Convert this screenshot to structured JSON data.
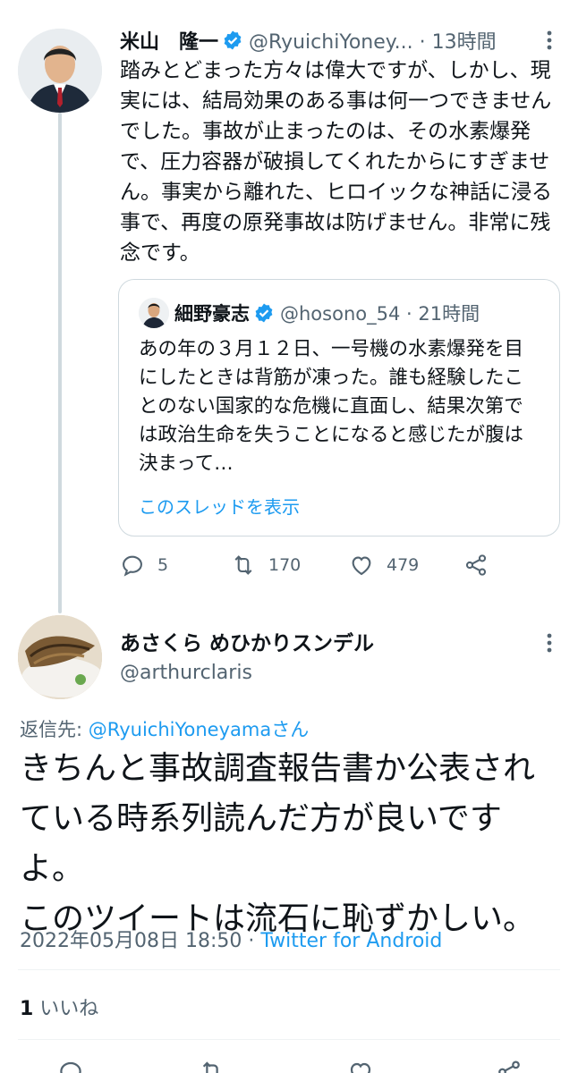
{
  "original_tweet": {
    "name": "米山　隆一",
    "handle": "@RyuichiYoney...",
    "time": "13時間",
    "text": "踏みとどまった方々は偉大ですが、しかし、現実には、結局効果のある事は何一つできませんでした。事故が止まったのは、その水素爆発で、圧力容器が破損してくれたからにすぎません。事実から離れた、ヒロイックな神話に浸る事で、再度の原発事故は防げません。非常に残念です。",
    "actions": {
      "reply_count": "5",
      "retweet_count": "170",
      "like_count": "479"
    }
  },
  "quoted_tweet": {
    "name": "細野豪志",
    "handle": "@hosono_54",
    "time": "21時間",
    "text": "あの年の３月１２日、一号機の水素爆発を目にしたときは背筋が凍った。誰も経験したことのない国家的な危機に直面し、結果次第では政治生命を失うことになると感じたが腹は決まって…",
    "show_thread": "このスレッドを表示"
  },
  "reply_tweet": {
    "name": "あさくら めひかりスンデル",
    "handle": "@arthurclaris",
    "replying_prefix": "返信先: ",
    "replying_mention": "@RyuichiYoneyamaさん",
    "text": "きちんと事故調査報告書か公表されている時系列読んだ方が良いですよ。\nこのツイートは流石に恥ずかしい。",
    "timestamp": "2022年05月08日 18:50",
    "separator": " · ",
    "client": "Twitter for Android",
    "likes_count": "1",
    "likes_label": " いいね"
  },
  "colors": {
    "accent": "#1d9bf0",
    "secondary_text": "#536471",
    "border": "#cfd9de"
  }
}
